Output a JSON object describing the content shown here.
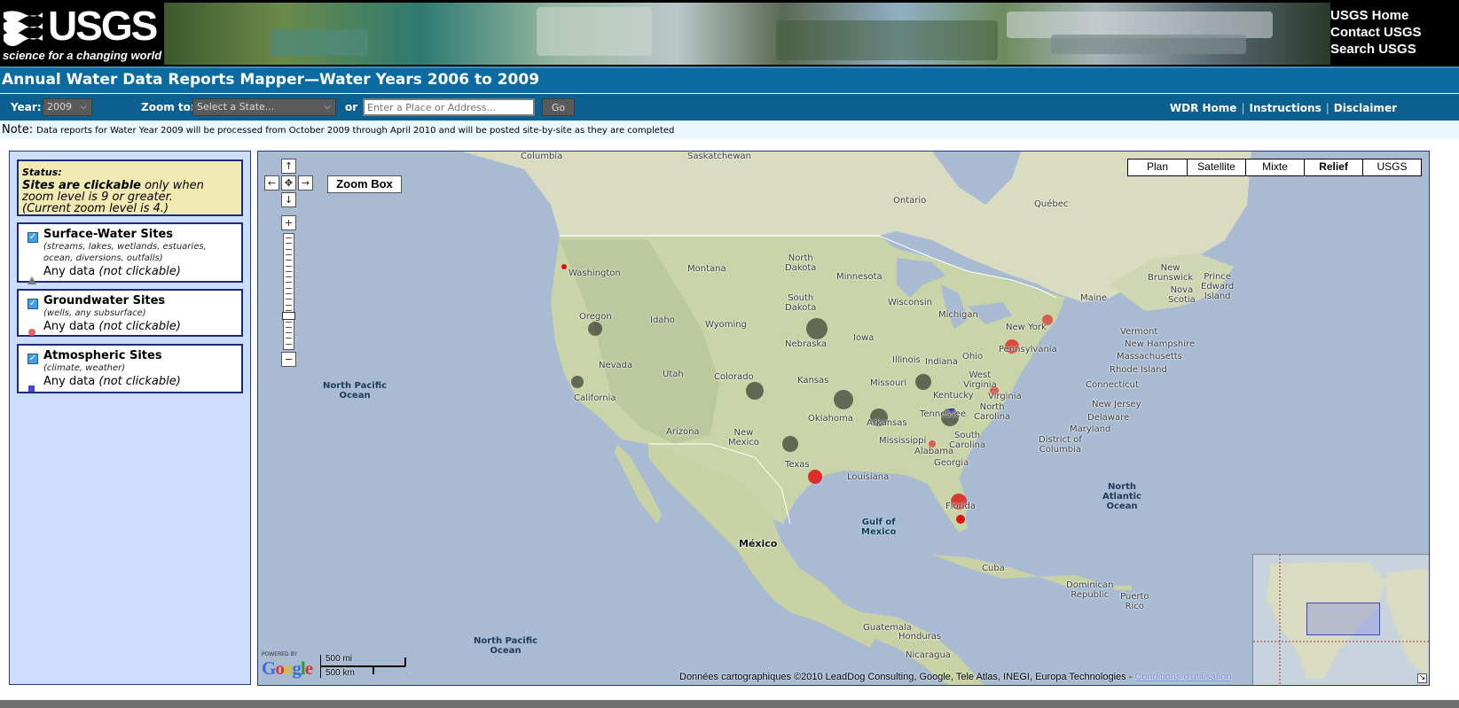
{
  "banner": {
    "logo_text": "USGS",
    "tagline": "science for a changing world",
    "links": [
      "USGS Home",
      "Contact USGS",
      "Search USGS"
    ]
  },
  "title": "Annual Water Data Reports Mapper—Water Years 2006 to 2009",
  "toolbar": {
    "year_label": "Year:",
    "year_value": "2009",
    "zoom_label": "Zoom to:",
    "state_placeholder": "Select a State...",
    "or_label": "or",
    "place_placeholder": "Enter a Place or Address...",
    "go_label": "Go",
    "links": [
      "WDR Home",
      "Instructions",
      "Disclaimer"
    ]
  },
  "note": {
    "label": "Note:",
    "text": "Data reports for Water Year 2009 will be processed from October 2009 through April 2010 and will be posted site-by-site as they are completed"
  },
  "panel": {
    "status_heading": "Status:",
    "status_bold": "Sites are clickable",
    "status_rest": " only when zoom level is 9 or greater.",
    "status_zoom": "(Current zoom level is 4.)",
    "layers": [
      {
        "title": "Surface-Water Sites",
        "subtitle": "(streams, lakes, wetlands, estuaries, ocean, diversions, outfalls)",
        "any": "Any data",
        "note": "(not clickable)",
        "symbol_color": "#777777"
      },
      {
        "title": "Groundwater Sites",
        "subtitle": "(wells, any subsurface)",
        "any": "Any data",
        "note": "(not clickable)",
        "symbol_color": "#f06060"
      },
      {
        "title": "Atmospheric Sites",
        "subtitle": "(climate, weather)",
        "any": "Any data",
        "note": "(not clickable)",
        "symbol_color": "#4646d8"
      }
    ]
  },
  "map": {
    "map_types": [
      "Plan",
      "Satellite",
      "Mixte",
      "Relief",
      "USGS"
    ],
    "active_type": "Relief",
    "zoom_box_label": "Zoom Box",
    "powered_by": "POWERED BY",
    "google": "Google",
    "scale_mi": "500 mi",
    "scale_km": "500 km",
    "copyright": "Données cartographiques ©2010 LeadDog Consulting, Google, Tele Atlas, INEGI, Europa Technologies -",
    "terms": "Conditions d'utilisation",
    "labels": {
      "columbia": "Columbia",
      "saskatchewan": "Saskatchewan",
      "ontario": "Ontario",
      "quebec": "Québec",
      "washington": "Washington",
      "montana": "Montana",
      "north_dakota": "North\nDakota",
      "minnesota": "Minnesota",
      "new_brunswick": "New\nBrunswick",
      "prince_edward": "Prince\nEdward\nIsland",
      "maine": "Maine",
      "nova_scotia": "Nova\nScotia",
      "oregon": "Oregon",
      "idaho": "Idaho",
      "south_dakota": "South\nDakota",
      "wyoming": "Wyoming",
      "wisconsin": "Wisconsin",
      "michigan": "Michigan",
      "new_york": "New York",
      "vermont": "Vermont",
      "new_hampshire": "New Hampshire",
      "massachusetts": "Massachusetts",
      "rhode_island": "Rhode Island",
      "connecticut": "Connecticut",
      "iowa": "Iowa",
      "nebraska": "Nebraska",
      "pennsylvania": "Pennsylvania",
      "illinois": "Illinois",
      "indiana": "Indiana",
      "ohio": "Ohio",
      "nevada": "Nevada",
      "utah": "Utah",
      "colorado": "Colorado",
      "north_pacific_1": "North Pacific\nOcean",
      "kansas": "Kansas",
      "missouri": "Missouri",
      "west_virginia": "West\nVirginia",
      "virginia": "Virginia",
      "kentucky": "Kentucky",
      "new_jersey": "New Jersey",
      "california": "California",
      "delaware": "Delaware",
      "maryland": "Maryland",
      "district_columbia": "District of\nColumbia",
      "tennessee": "Tennessee",
      "north_carolina": "North\nCarolina",
      "oklahoma": "Oklahoma",
      "arkansas": "Arkansas",
      "arizona": "Arizona",
      "new_mexico": "New\nMexico",
      "mississippi": "Mississippi",
      "alabama": "Alabama",
      "south_carolina": "South\nCarolina",
      "georgia": "Georgia",
      "texas": "Texas",
      "louisiana": "Louisiana",
      "north_atlantic": "North\nAtlantic\nOcean",
      "florida": "Florida",
      "gulf_mexico": "Gulf of\nMexico",
      "mexico": "México",
      "cuba": "Cuba",
      "dominican": "Dominican\nRepublic",
      "puerto_rico": "Puerto\nRico",
      "guatemala": "Guatemala",
      "honduras": "Honduras",
      "nicaragua": "Nicaragua",
      "north_pacific_2": "North Pacific\nOcean"
    }
  }
}
